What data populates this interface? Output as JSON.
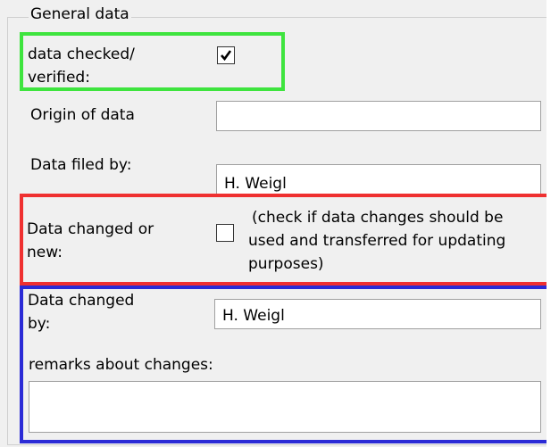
{
  "group": {
    "title": "General data"
  },
  "checked": {
    "label_line1": "data checked/",
    "label_line2": "verified:",
    "value": true
  },
  "origin": {
    "label": "Origin of data",
    "value": ""
  },
  "filed_by": {
    "label": "Data filed by:",
    "value": "H. Weigl"
  },
  "changed_or_new": {
    "label_line1": "Data changed or",
    "label_line2": "new:",
    "value": false,
    "hint_line1": "(check if data changes should be",
    "hint_line2": "used and transferred for updating",
    "hint_line3": "purposes)"
  },
  "changed_by": {
    "label_line1": "Data changed",
    "label_line2": "by:",
    "value": "H. Weigl"
  },
  "remarks": {
    "label": "remarks about changes:",
    "value": ""
  },
  "highlights": {
    "green": "#3ee43e",
    "red": "#ef3030",
    "blue": "#2b2bd6"
  }
}
